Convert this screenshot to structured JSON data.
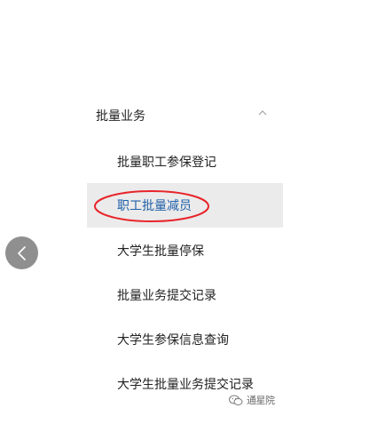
{
  "menu": {
    "group_title": "批量业务",
    "items": [
      {
        "label": "批量职工参保登记"
      },
      {
        "label": "职工批量减员"
      },
      {
        "label": "大学生批量停保"
      },
      {
        "label": "批量业务提交记录"
      },
      {
        "label": "大学生参保信息查询"
      },
      {
        "label": "大学生批量业务提交记录"
      }
    ]
  },
  "icons": {
    "group_toggle": "chevron-up-icon",
    "back": "chevron-left-icon",
    "watermark": "wechat-icon"
  },
  "watermark": {
    "text": "通星院"
  },
  "colors": {
    "selected_background": "#ebebeb",
    "selected_text": "#1f5fa8",
    "annotation": "#e8242a",
    "back_button": "#8f8f8f"
  }
}
